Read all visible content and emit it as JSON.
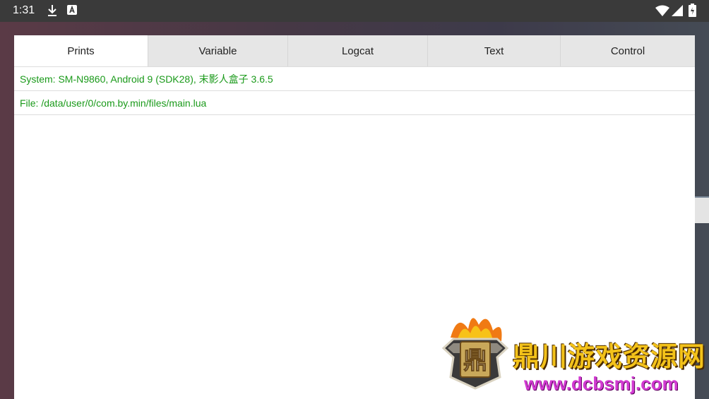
{
  "status_bar": {
    "time": "1:31",
    "icons": [
      "download-icon",
      "a-notification-icon",
      "wifi-icon",
      "signal-icon",
      "battery-icon"
    ]
  },
  "dialog": {
    "tabs": [
      {
        "label": "Prints",
        "active": true
      },
      {
        "label": "Variable",
        "active": false
      },
      {
        "label": "Logcat",
        "active": false
      },
      {
        "label": "Text",
        "active": false
      },
      {
        "label": "Control",
        "active": false
      }
    ],
    "rows": [
      {
        "text": "System: SM-N9860, Android 9 (SDK28), 末影人盒子 3.6.5"
      },
      {
        "text": "File: /data/user/0/com.by.min/files/main.lua"
      }
    ],
    "row_color": "#1a9a1a"
  },
  "watermark": {
    "logo_text": "鼎",
    "title": "鼎川游戏资源网",
    "url": "www.dcbsmj.com"
  }
}
